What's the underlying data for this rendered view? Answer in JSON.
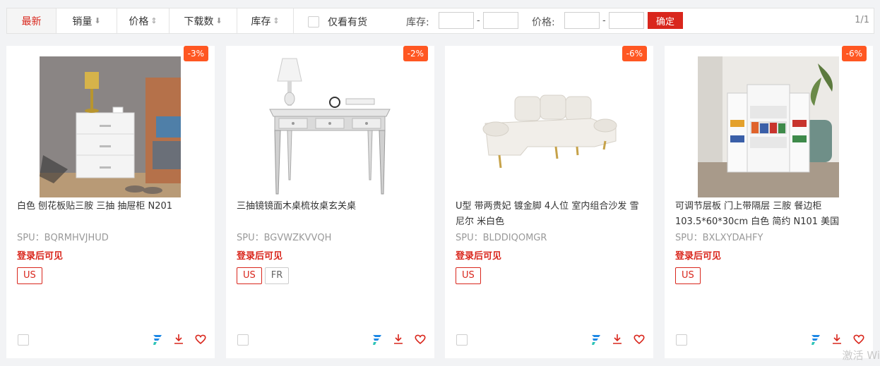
{
  "filter": {
    "sorts": [
      {
        "label": "最新",
        "arrow": ""
      },
      {
        "label": "销量",
        "arrow": "⬇"
      },
      {
        "label": "价格",
        "arrow": "⇕"
      },
      {
        "label": "下载数",
        "arrow": "⬇"
      },
      {
        "label": "库存",
        "arrow": "⇕"
      }
    ],
    "only_stock_label": "仅看有货",
    "stock_label": "库存:",
    "price_label": "价格:",
    "range_sep": "-",
    "confirm_label": "确定",
    "pager": "1/1"
  },
  "products": [
    {
      "discount": "-3%",
      "title": "白色 刨花板贴三胺 三抽 抽屉柜 N201",
      "spu": "SPU：BQRMHVJHUD",
      "login_note": "登录后可见",
      "tags": [
        "US"
      ],
      "image": "white-nightstand"
    },
    {
      "discount": "-2%",
      "title": "三抽镜镜面木桌梳妆桌玄关桌",
      "spu": "SPU：BGVWZKVVQH",
      "login_note": "登录后可见",
      "tags": [
        "US",
        "FR"
      ],
      "image": "mirrored-desk"
    },
    {
      "discount": "-6%",
      "title": "U型 带两贵妃 镀金脚 4人位 室内组合沙发 雪尼尔 米白色",
      "spu": "SPU：BLDDIQOMGR",
      "login_note": "登录后可见",
      "tags": [
        "US"
      ],
      "image": "u-shaped-sofa"
    },
    {
      "discount": "-6%",
      "title": "可调节层板 门上带隔层 三胺 餐边柜 103.5*60*30cm 白色 简约 N101 美国",
      "spu": "SPU：BXLXYDAHFY",
      "login_note": "登录后可见",
      "tags": [
        "US"
      ],
      "image": "pantry-cabinet"
    }
  ],
  "icons": [
    "checkbox-icon",
    "flash-icon",
    "download-icon",
    "heart-icon"
  ],
  "colors": {
    "accent": "#d9261c",
    "discount": "#ff5722",
    "flash": "#1e88e5"
  },
  "watermark": "激活 Wi"
}
